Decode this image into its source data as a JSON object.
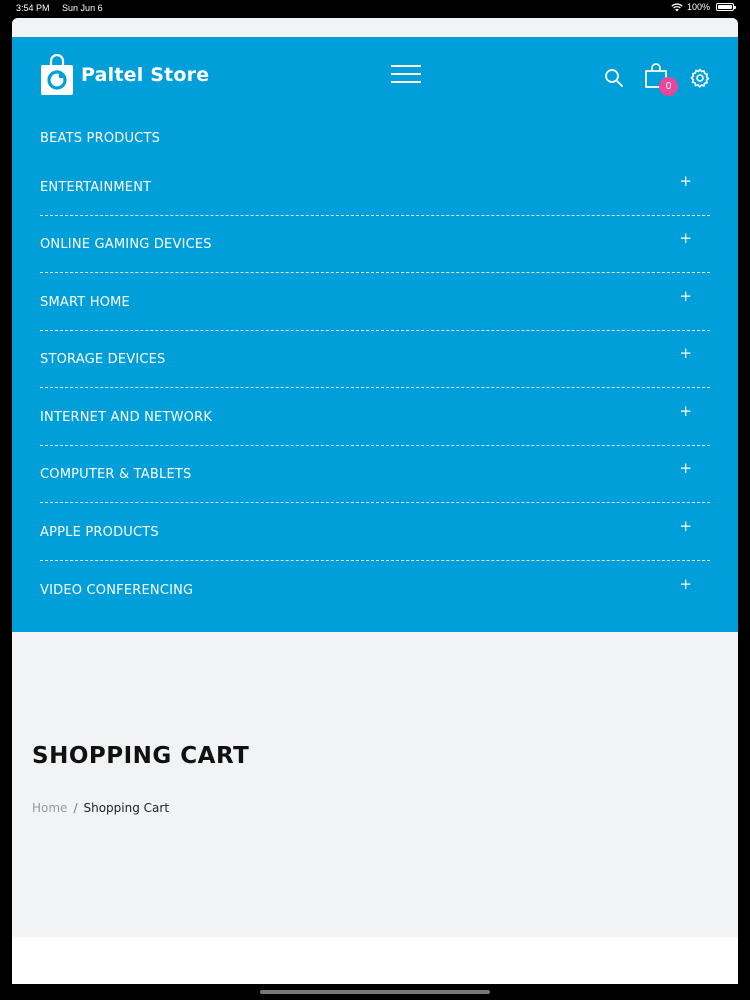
{
  "status_bar": {
    "time": "3:54 PM",
    "date": "Sun Jun 6",
    "battery": "100%"
  },
  "brand": {
    "name": "Paltel Store"
  },
  "cart": {
    "count": "0"
  },
  "menu": {
    "items": [
      {
        "label": "BEATS PRODUCTS",
        "expand": ""
      },
      {
        "label": "ENTERTAINMENT",
        "expand": "+"
      },
      {
        "label": "ONLINE GAMING DEVICES",
        "expand": "+"
      },
      {
        "label": "SMART HOME",
        "expand": "+"
      },
      {
        "label": "STORAGE DEVICES",
        "expand": "+"
      },
      {
        "label": "INTERNET AND NETWORK",
        "expand": "+"
      },
      {
        "label": "COMPUTER & TABLETS",
        "expand": "+"
      },
      {
        "label": "APPLE PRODUCTS",
        "expand": "+"
      },
      {
        "label": "VIDEO CONFERENCING",
        "expand": "+"
      }
    ]
  },
  "page": {
    "title": "SHOPPING CART",
    "breadcrumb": {
      "home": "Home",
      "separator": "/",
      "current": "Shopping Cart"
    }
  },
  "colors": {
    "header_bg": "#009fd9",
    "badge": "#e8479a",
    "page_bg": "#f2f3f4"
  },
  "icons": {
    "logo": "shopping-bag-logo-icon",
    "menu": "hamburger-icon",
    "search": "search-icon",
    "cart": "shopping-bag-icon",
    "settings": "gear-icon"
  }
}
